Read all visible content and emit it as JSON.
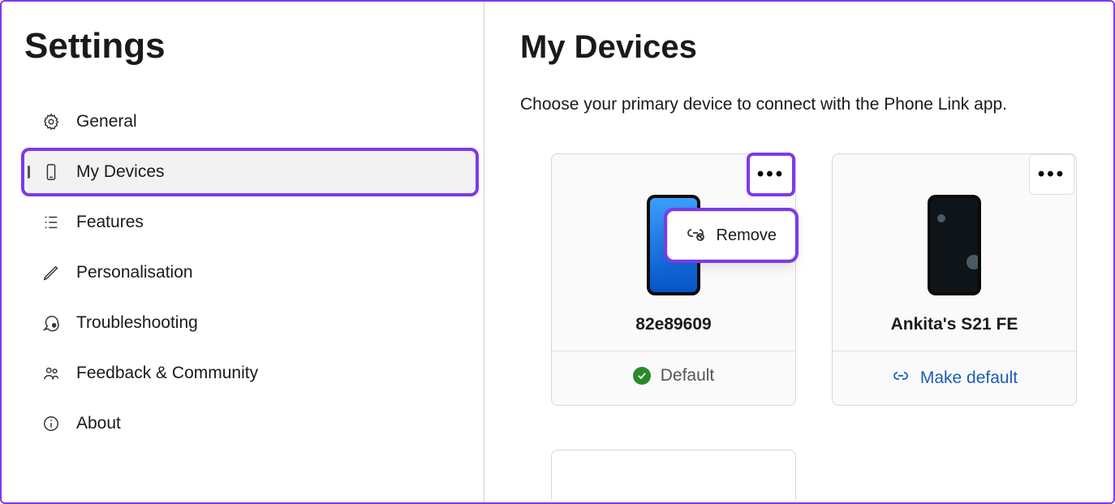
{
  "sidebar": {
    "title": "Settings",
    "items": [
      {
        "label": "General",
        "icon": "gear"
      },
      {
        "label": "My Devices",
        "icon": "phone",
        "active": true,
        "highlighted": true
      },
      {
        "label": "Features",
        "icon": "list"
      },
      {
        "label": "Personalisation",
        "icon": "pen"
      },
      {
        "label": "Troubleshooting",
        "icon": "bubble-question"
      },
      {
        "label": "Feedback & Community",
        "icon": "people"
      },
      {
        "label": "About",
        "icon": "info"
      }
    ]
  },
  "main": {
    "title": "My Devices",
    "subtitle": "Choose your primary device to connect with the Phone Link app.",
    "devices": [
      {
        "name": "82e89609",
        "screen": "blue",
        "footer_label": "Default",
        "footer_type": "default",
        "more_highlighted": true,
        "menu_open": true
      },
      {
        "name": "Ankita's S21 FE",
        "screen": "space",
        "footer_label": "Make default",
        "footer_type": "link",
        "more_highlighted": false,
        "menu_open": false
      }
    ],
    "menu": {
      "remove_label": "Remove"
    }
  }
}
